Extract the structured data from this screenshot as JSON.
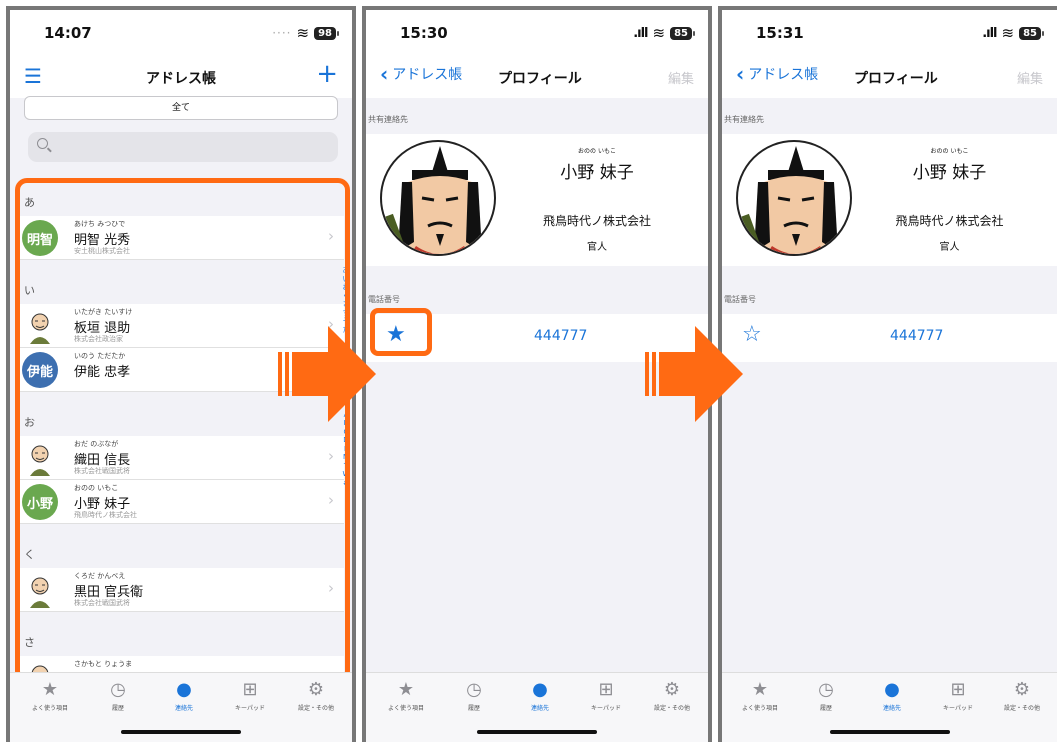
{
  "panel1": {
    "time": "14:07",
    "battery": "98",
    "title": "アドレス帳",
    "filter": "全て",
    "sections": [
      {
        "head": "あ",
        "rows": [
          {
            "kana": "あけち みつひで",
            "name": "明智 光秀",
            "org": "安土桃山株式会社",
            "avatar": "明智",
            "color": "#6aa84f"
          }
        ]
      },
      {
        "head": "い",
        "rows": [
          {
            "kana": "いたがき たいすけ",
            "name": "板垣 退助",
            "org": "株式会社政治家",
            "avatar": "",
            "color": ""
          },
          {
            "kana": "いのう ただたか",
            "name": "伊能 忠孝",
            "org": "",
            "avatar": "伊能",
            "color": "#3d6fb0"
          }
        ]
      },
      {
        "head": "お",
        "rows": [
          {
            "kana": "おだ のぶなが",
            "name": "織田 信長",
            "org": "株式会社戦国武将",
            "avatar": "",
            "color": ""
          },
          {
            "kana": "おのの いもこ",
            "name": "小野 妹子",
            "org": "飛鳥時代ノ株式会社",
            "avatar": "小野",
            "color": "#6aa84f"
          }
        ]
      },
      {
        "head": "く",
        "rows": [
          {
            "kana": "くろだ かんべえ",
            "name": "黒田 官兵衛",
            "org": "株式会社戦国武将",
            "avatar": "",
            "color": ""
          }
        ]
      },
      {
        "head": "さ",
        "rows": [
          {
            "kana": "さかもと りょうま",
            "name": "坂本 龍馬",
            "org": "",
            "avatar": "",
            "color": ""
          }
        ]
      }
    ],
    "index": [
      "あ",
      "い",
      "お",
      "く",
      "さ",
      "す",
      "そ",
      "た",
      "",
      "",
      "",
      "",
      "",
      "",
      "",
      "",
      "",
      "A",
      "B",
      "C",
      "D",
      "F",
      "M",
      "T",
      "W",
      "#"
    ]
  },
  "panel2": {
    "time": "15:30",
    "battery": "85",
    "back": "アドレス帳",
    "title": "プロフィール",
    "edit": "編集",
    "shared_label": "共有連絡先",
    "kana": "おのの いもこ",
    "name": "小野 妹子",
    "company": "飛鳥時代ノ株式会社",
    "job": "官人",
    "phone_label": "電話番号",
    "phone": "444777",
    "star": "★"
  },
  "panel3": {
    "time": "15:31",
    "battery": "85",
    "back": "アドレス帳",
    "title": "プロフィール",
    "edit": "編集",
    "shared_label": "共有連絡先",
    "kana": "おのの いもこ",
    "name": "小野 妹子",
    "company": "飛鳥時代ノ株式会社",
    "job": "官人",
    "phone_label": "電話番号",
    "phone": "444777",
    "star": "☆"
  },
  "tabs": [
    {
      "label": "よく使う項目",
      "icon": "star-icon"
    },
    {
      "label": "履歴",
      "icon": "clock-icon"
    },
    {
      "label": "連絡先",
      "icon": "person-icon"
    },
    {
      "label": "キーパッド",
      "icon": "keypad-icon"
    },
    {
      "label": "設定・その他",
      "icon": "gear-icon"
    }
  ],
  "colors": {
    "accent": "#1a74d8",
    "highlight": "#ff6a13"
  }
}
